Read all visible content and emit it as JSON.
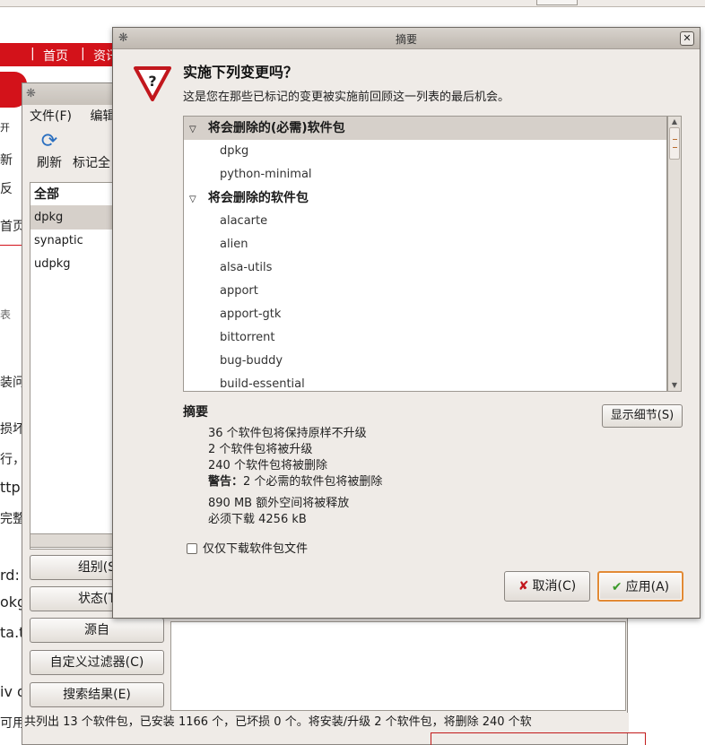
{
  "browser": {
    "nav_items": [
      "首页",
      "资讯"
    ],
    "side_texts": [
      "开",
      "新",
      "反",
      "首页",
      "表",
      "装问",
      "损坏",
      "行，",
      "ttp",
      "完整",
      "rd:",
      "okg",
      "ta.t",
      "iv d",
      "可用"
    ]
  },
  "synaptic": {
    "menu": {
      "file": "文件(F)",
      "edit": "编辑"
    },
    "toolbar": {
      "refresh": "刷新",
      "mark_all": "标记全"
    },
    "filters": [
      "全部",
      "dpkg",
      "synaptic",
      "udpkg"
    ],
    "side_buttons": {
      "sections": "组别(S",
      "status": "状态(T",
      "origin": "源自",
      "custom": "自定义过滤器(C)",
      "search": "搜索结果(E)"
    },
    "status_bar": "共列出 13 个软件包，已安装 1166 个，已坏损 0 个。将安装/升级 2 个软件包，将删除 240 个软"
  },
  "dialog": {
    "title": "摘要",
    "heading": "实施下列变更吗？",
    "subtext": "这是您在那些已标记的变更被实施前回顾这一列表的最后机会。",
    "groups": [
      {
        "label": "将会删除的(必需)软件包",
        "packages": [
          "dpkg",
          "python-minimal"
        ]
      },
      {
        "label": "将会删除的软件包",
        "packages": [
          "alacarte",
          "alien",
          "alsa-utils",
          "apport",
          "apport-gtk",
          "bittorrent",
          "bug-buddy",
          "build-essential"
        ]
      }
    ],
    "summary_label": "摘要",
    "details_button": "显示细节(S)",
    "summary_lines": [
      "36 个软件包将保持原样不升级",
      "2 个软件包将被升级",
      "240 个软件包将被删除"
    ],
    "warning_prefix": "警告：",
    "warning_text": "2 个必需的软件包将被删除",
    "space_line": "890 MB 额外空间将被释放",
    "download_line": "必须下载 4256 kB",
    "download_only_label": "仅仅下载软件包文件",
    "cancel_button": "取消(C)",
    "apply_button": "应用(A)",
    "colors": {
      "accent": "#e28a35",
      "warning_red": "#c2171d",
      "selection": "#d6d0ca"
    }
  }
}
